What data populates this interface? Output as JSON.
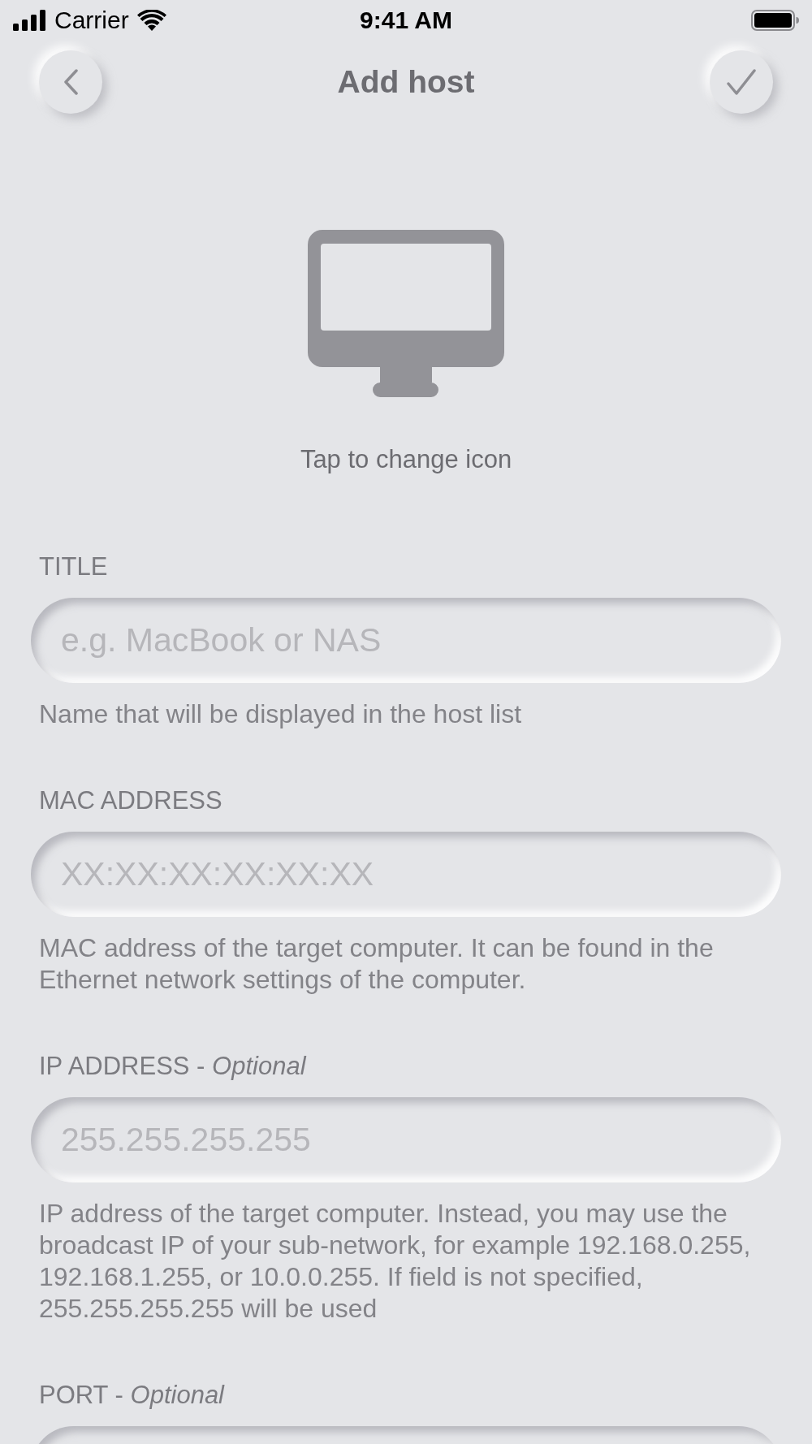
{
  "status_bar": {
    "carrier": "Carrier",
    "time": "9:41 AM"
  },
  "nav": {
    "title": "Add host"
  },
  "icon_picker": {
    "caption": "Tap to change icon"
  },
  "fields": [
    {
      "label": "TITLE",
      "placeholder": "e.g. MacBook or NAS",
      "hint": "Name that will be displayed in the host list"
    },
    {
      "label": "MAC ADDRESS",
      "placeholder": "XX:XX:XX:XX:XX:XX",
      "hint": "MAC address of the target computer. It can be found in the Ethernet network settings of the computer."
    },
    {
      "label": "IP ADDRESS - *Optional*",
      "placeholder": "255.255.255.255",
      "hint": "IP address of the target computer. Instead, you may use the broadcast IP of your sub-network, for example 192.168.0.255, 192.168.1.255, or 10.0.0.255. If field is not specified, 255.255.255.255 will be used"
    },
    {
      "label": "PORT - *Optional*"
    }
  ]
}
